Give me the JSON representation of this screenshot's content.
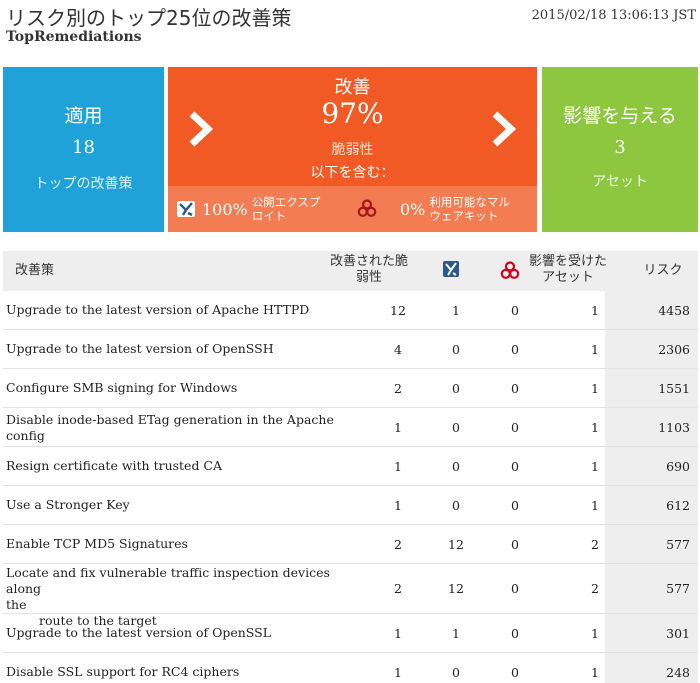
{
  "header": {
    "title": "リスク別のトップ25位の改善策",
    "date": "2015/02/18 13:06:13 JST",
    "subtitle": "TopRemediations"
  },
  "tiles": {
    "apply": {
      "title": "適用",
      "value": "18",
      "label": "トップの改善策",
      "color": "#1ea2d8"
    },
    "remediation": {
      "title": "改善",
      "percent": "97%",
      "vuln_label": "脆弱性",
      "includes_label": "以下を含む：",
      "exploit_percent": "100%",
      "exploit_text_1": "公開エクスプ",
      "exploit_text_2": "ロイト",
      "malware_percent": "0%",
      "malware_text_1": "利用可能なマル",
      "malware_text_2": "ウェアキット",
      "color": "#f15a24"
    },
    "impact": {
      "title": "影響を与える",
      "value": "3",
      "label": "アセット",
      "color": "#8dc63f"
    }
  },
  "table": {
    "headers": {
      "name": "改善策",
      "vuln_1": "改善された脆",
      "vuln_2": "弱性",
      "assets_1": "影響を受けた",
      "assets_2": "アセット",
      "risk": "リスク"
    },
    "rows": [
      {
        "name": "Upgrade to the latest version of Apache HTTPD",
        "vuln": "12",
        "exploits": "1",
        "malware": "0",
        "assets": "1",
        "risk": "4458"
      },
      {
        "name": "Upgrade to the latest version of OpenSSH",
        "vuln": "4",
        "exploits": "0",
        "malware": "0",
        "assets": "1",
        "risk": "2306"
      },
      {
        "name": "Configure SMB signing for Windows",
        "vuln": "2",
        "exploits": "0",
        "malware": "0",
        "assets": "1",
        "risk": "1551"
      },
      {
        "name": "Disable inode-based ETag generation in the Apache config",
        "vuln": "1",
        "exploits": "0",
        "malware": "0",
        "assets": "1",
        "risk": "1103"
      },
      {
        "name": "Resign certificate with trusted CA",
        "vuln": "1",
        "exploits": "0",
        "malware": "0",
        "assets": "1",
        "risk": "690"
      },
      {
        "name": "Use a Stronger Key",
        "vuln": "1",
        "exploits": "0",
        "malware": "0",
        "assets": "1",
        "risk": "612"
      },
      {
        "name": "Enable TCP MD5 Signatures",
        "vuln": "2",
        "exploits": "12",
        "malware": "0",
        "assets": "2",
        "risk": "577"
      },
      {
        "name_1": "Locate and fix vulnerable traffic inspection devices along",
        "name_2": "the",
        "name_3": "route to the target",
        "vuln": "2",
        "exploits": "12",
        "malware": "0",
        "assets": "2",
        "risk": "577"
      },
      {
        "name": "Upgrade to the latest version of OpenSSL",
        "vuln": "1",
        "exploits": "1",
        "malware": "0",
        "assets": "1",
        "risk": "301"
      },
      {
        "name": "Disable SSL support for RC4 ciphers",
        "vuln": "1",
        "exploits": "0",
        "malware": "0",
        "assets": "1",
        "risk": "248"
      }
    ]
  },
  "icons": {
    "exploit": "exploit-icon",
    "malware": "biohazard-icon"
  },
  "colors": {
    "malware_red": "#d0021b",
    "exploit_blue": "#2a5a8c"
  }
}
